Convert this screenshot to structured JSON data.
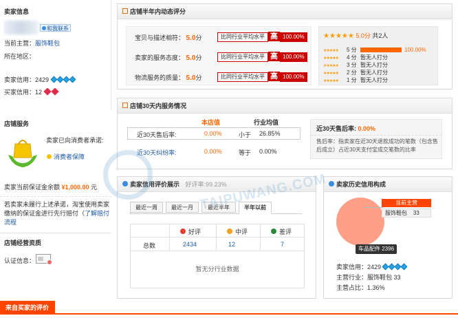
{
  "seller_info": {
    "title": "卖家信息",
    "contact": "和我联系",
    "main_label": "当前主营：",
    "main_value": "服饰鞋包",
    "region_label": "所在地区：",
    "credit_label": "卖家信用：",
    "credit_value": "2429",
    "buyer_credit_label": "买家信用：",
    "buyer_credit_value": "12"
  },
  "shop_service": {
    "title": "店铺服务",
    "promise": "卖家已向消费者承诺:",
    "guarantee": "消费者保障",
    "deposit_label": "卖家当前保证金余额",
    "deposit_value": "¥1,000.00",
    "deposit_unit": "元",
    "notice": "若卖家未履行上述承诺，淘宝使用卖家缴纳的保证金进行先行赔付（",
    "notice_link": "了解赔付流程"
  },
  "shop_qualification": {
    "title": "店铺经营资质",
    "cert_label": "认证信息："
  },
  "buyer_reviews": {
    "title": "来自买家的评价"
  },
  "ratings": {
    "title": "店铺半年内动态评分",
    "rows": [
      {
        "label": "宝贝与描述相符：",
        "score": "5.0",
        "unit": "分",
        "compare": "比同行业平均水平",
        "level": "高",
        "pct": "100.00%"
      },
      {
        "label": "卖家的服务态度：",
        "score": "5.0",
        "unit": "分",
        "compare": "比同行业平均水平",
        "level": "高",
        "pct": "100.00%"
      },
      {
        "label": "物流服务的质量：",
        "score": "5.0",
        "unit": "分",
        "compare": "比同行业平均水平",
        "level": "高",
        "pct": "100.00%"
      }
    ],
    "summary_score": "5.0分",
    "summary_count": "共2人",
    "dist": [
      {
        "label": "5 分",
        "value": "100.00%",
        "fill": 1.0
      },
      {
        "label": "4 分",
        "value": "暂无人打分",
        "fill": 0
      },
      {
        "label": "3 分",
        "value": "暂无人打分",
        "fill": 0
      },
      {
        "label": "2 分",
        "value": "暂无人打分",
        "fill": 0
      },
      {
        "label": "1 分",
        "value": "暂无人打分",
        "fill": 0
      }
    ]
  },
  "service30": {
    "title": "店铺30天内服务情况",
    "col_shop": "本店值",
    "col_industry": "行业均值",
    "rows": [
      {
        "label": "近30天售后率:",
        "shop": "0.00%",
        "cmp": "小于",
        "industry": "26.85%"
      },
      {
        "label": "近30天纠纷率:",
        "shop": "0.00%",
        "cmp": "等于",
        "industry": "0.00%"
      }
    ],
    "detail_title": "近30天售后率:",
    "detail_value": "0.00%",
    "detail_desc": "售后率：指卖家在近30天退款成功的笔数（包含售后成立）占近30天支付宝成交笔数的比率"
  },
  "credit_eval": {
    "title": "卖家信用评价展示",
    "good_rate_label": "好评率:",
    "good_rate": "99.23%",
    "tabs": [
      "最近一周",
      "最近一月",
      "最近半年",
      "半年以前"
    ],
    "active_tab": 3,
    "headers": [
      "好评",
      "中评",
      "差评"
    ],
    "row_label": "总数",
    "values": [
      "2434",
      "12",
      "7"
    ],
    "empty": "暂无分行业数据"
  },
  "history": {
    "title": "卖家历史信用构成",
    "pie_label": "当前主营",
    "pie_cat": "服饰鞋包",
    "pie_cat_value": "33",
    "tooltip": "车品配件 2396",
    "credit_label": "卖家信用：",
    "credit_value": "2429",
    "industry_label": "主营行业：",
    "industry_value": "服饰鞋包 33",
    "share_label": "主营占比：",
    "share_value": "1.36%"
  },
  "watermark": {
    "text": "TAIPUWANG.COM"
  }
}
